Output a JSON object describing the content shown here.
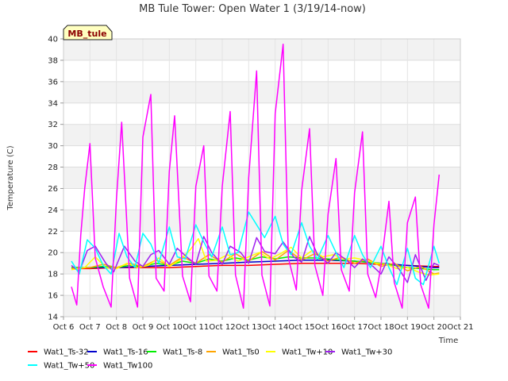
{
  "chart_data": {
    "type": "line",
    "title": "MB Tule Tower: Open Water 1 (3/19/14-now)",
    "xlabel": "Time",
    "ylabel": "Temperature (C)",
    "badge": "MB_tule",
    "xlim": [
      6,
      21
    ],
    "ylim": [
      14,
      40
    ],
    "grid": true,
    "legend_position": "bottom",
    "x_ticks": [
      {
        "x": 6,
        "label": "Oct 6"
      },
      {
        "x": 7,
        "label": "Oct 7"
      },
      {
        "x": 8,
        "label": "Oct 8"
      },
      {
        "x": 9,
        "label": "Oct 9"
      },
      {
        "x": 10,
        "label": "Oct 10"
      },
      {
        "x": 11,
        "label": "Oct 11"
      },
      {
        "x": 12,
        "label": "Oct 12"
      },
      {
        "x": 13,
        "label": "Oct 13"
      },
      {
        "x": 14,
        "label": "Oct 14"
      },
      {
        "x": 15,
        "label": "Oct 15"
      },
      {
        "x": 16,
        "label": "Oct 16"
      },
      {
        "x": 17,
        "label": "Oct 17"
      },
      {
        "x": 18,
        "label": "Oct 18"
      },
      {
        "x": 19,
        "label": "Oct 19"
      },
      {
        "x": 20,
        "label": "Oct 20"
      },
      {
        "x": 21,
        "label": "Oct 21"
      }
    ],
    "y_ticks": [
      14,
      16,
      18,
      20,
      22,
      24,
      26,
      28,
      30,
      32,
      34,
      36,
      38,
      40
    ],
    "series": [
      {
        "name": "Wat1_Ts-32",
        "color": "#ff0000",
        "x": [
          6.3,
          7.0,
          8.0,
          9.0,
          10.0,
          11.0,
          12.0,
          13.0,
          14.0,
          15.0,
          16.0,
          17.0,
          18.0,
          19.0,
          20.0,
          20.2
        ],
        "y": [
          18.5,
          18.5,
          18.6,
          18.6,
          18.6,
          18.7,
          18.8,
          18.8,
          18.9,
          19.0,
          19.0,
          19.0,
          18.9,
          18.8,
          18.7,
          18.7
        ]
      },
      {
        "name": "Wat1_Ts-16",
        "color": "#0000cc",
        "x": [
          6.3,
          7.0,
          8.0,
          9.0,
          10.0,
          11.0,
          12.0,
          13.0,
          14.0,
          15.0,
          16.0,
          17.0,
          18.0,
          19.0,
          20.0,
          20.2
        ],
        "y": [
          18.6,
          18.6,
          18.6,
          18.7,
          18.8,
          18.9,
          19.0,
          19.1,
          19.2,
          19.3,
          19.3,
          19.2,
          19.0,
          18.8,
          18.6,
          18.6
        ]
      },
      {
        "name": "Wat1_Ts-8",
        "color": "#00ee00",
        "x": [
          6.3,
          7.0,
          7.5,
          8.0,
          8.5,
          9.0,
          9.5,
          10.0,
          10.5,
          11.0,
          11.5,
          12.0,
          12.5,
          13.0,
          13.5,
          14.0,
          14.5,
          15.0,
          15.5,
          16.0,
          16.5,
          17.0,
          17.5,
          18.0,
          18.5,
          19.0,
          19.5,
          20.0,
          20.2
        ],
        "y": [
          18.6,
          18.6,
          18.7,
          18.6,
          18.8,
          18.7,
          19.0,
          18.8,
          19.2,
          19.0,
          19.4,
          19.2,
          19.5,
          19.3,
          19.6,
          19.4,
          19.6,
          19.5,
          19.5,
          19.4,
          19.3,
          19.2,
          19.1,
          19.0,
          18.8,
          18.6,
          18.5,
          18.4,
          18.4
        ]
      },
      {
        "name": "Wat1_Ts0",
        "color": "#ffa500",
        "x": [
          6.3,
          7.0,
          7.5,
          8.0,
          8.5,
          9.0,
          9.5,
          10.0,
          10.5,
          11.0,
          11.5,
          12.0,
          12.5,
          13.0,
          13.5,
          14.0,
          14.5,
          15.0,
          15.5,
          16.0,
          16.5,
          17.0,
          17.5,
          18.0,
          18.5,
          19.0,
          19.5,
          20.0,
          20.2
        ],
        "y": [
          18.5,
          18.6,
          18.9,
          18.6,
          19.0,
          18.7,
          19.3,
          18.8,
          19.6,
          19.0,
          19.8,
          19.1,
          19.9,
          19.2,
          20.1,
          19.3,
          20.2,
          19.3,
          19.9,
          19.2,
          19.6,
          19.0,
          19.4,
          18.7,
          19.0,
          18.3,
          18.7,
          18.0,
          18.1
        ]
      },
      {
        "name": "Wat1_Tw+10",
        "color": "#ffff00",
        "x": [
          6.3,
          6.8,
          7.2,
          7.6,
          8.0,
          8.4,
          8.8,
          9.2,
          9.6,
          10.0,
          10.4,
          10.8,
          11.1,
          11.4,
          11.8,
          12.2,
          12.6,
          13.0,
          13.4,
          13.8,
          14.2,
          14.6,
          15.0,
          15.4,
          15.8,
          16.2,
          16.6,
          17.0,
          17.4,
          17.8,
          18.2,
          18.6,
          19.0,
          19.4,
          19.8,
          20.2
        ],
        "y": [
          18.4,
          18.6,
          19.6,
          18.6,
          18.5,
          19.0,
          18.6,
          18.8,
          19.5,
          18.7,
          19.3,
          20.3,
          21.3,
          19.2,
          19.3,
          19.8,
          19.2,
          19.6,
          20.0,
          19.4,
          19.9,
          20.5,
          19.5,
          20.2,
          19.6,
          19.8,
          19.4,
          19.5,
          19.3,
          19.0,
          18.9,
          18.5,
          18.6,
          18.2,
          17.9,
          18.0
        ]
      },
      {
        "name": "Wat1_Tw+30",
        "color": "#a020f0",
        "x": [
          6.3,
          6.6,
          6.9,
          7.2,
          7.6,
          7.9,
          8.3,
          8.7,
          9.0,
          9.3,
          9.6,
          10.0,
          10.3,
          10.7,
          11.0,
          11.3,
          11.6,
          12.0,
          12.3,
          12.7,
          13.0,
          13.3,
          13.6,
          14.0,
          14.3,
          14.7,
          15.0,
          15.3,
          15.6,
          16.0,
          16.3,
          16.7,
          17.0,
          17.3,
          17.7,
          18.0,
          18.3,
          18.7,
          19.0,
          19.3,
          19.7,
          20.0,
          20.2
        ],
        "y": [
          18.8,
          18.2,
          20.2,
          20.6,
          19.0,
          18.2,
          20.6,
          19.2,
          18.7,
          19.8,
          20.2,
          18.9,
          20.4,
          19.5,
          18.9,
          21.5,
          20.0,
          18.9,
          20.6,
          20.0,
          19.0,
          21.4,
          20.1,
          19.9,
          21.0,
          19.6,
          19.1,
          21.5,
          19.8,
          19.0,
          20.0,
          19.3,
          18.6,
          19.4,
          18.7,
          18.0,
          19.6,
          18.4,
          17.2,
          19.8,
          17.4,
          19.0,
          18.8
        ]
      },
      {
        "name": "Wat1_Tw+50",
        "color": "#00ffff",
        "x": [
          6.3,
          6.6,
          6.9,
          7.2,
          7.5,
          7.8,
          8.1,
          8.4,
          8.7,
          9.0,
          9.3,
          9.6,
          10.0,
          10.3,
          10.6,
          11.0,
          11.3,
          11.6,
          12.0,
          12.3,
          12.6,
          13.0,
          13.3,
          13.6,
          14.0,
          14.3,
          14.6,
          15.0,
          15.3,
          15.6,
          16.0,
          16.3,
          16.6,
          17.0,
          17.3,
          17.6,
          18.0,
          18.3,
          18.6,
          19.0,
          19.3,
          19.6,
          20.0,
          20.2
        ],
        "y": [
          19.2,
          18.0,
          21.2,
          20.4,
          18.8,
          18.0,
          21.8,
          19.6,
          18.6,
          21.8,
          20.8,
          19.0,
          22.4,
          19.6,
          19.4,
          22.6,
          21.0,
          19.6,
          22.4,
          19.8,
          20.0,
          23.8,
          22.6,
          21.4,
          23.4,
          20.8,
          19.8,
          22.8,
          20.6,
          19.4,
          21.6,
          20.0,
          18.6,
          21.6,
          19.8,
          18.6,
          20.6,
          18.6,
          17.0,
          20.4,
          17.6,
          17.0,
          20.6,
          19.0
        ]
      },
      {
        "name": "Wat1_Tw100",
        "color": "#ff00ff",
        "x": [
          6.3,
          6.5,
          6.65,
          6.8,
          7.0,
          7.2,
          7.5,
          7.8,
          8.0,
          8.2,
          8.5,
          8.8,
          9.0,
          9.3,
          9.5,
          9.8,
          10.0,
          10.2,
          10.5,
          10.8,
          11.0,
          11.3,
          11.5,
          11.8,
          12.0,
          12.3,
          12.5,
          12.8,
          13.0,
          13.3,
          13.5,
          13.8,
          14.0,
          14.3,
          14.5,
          14.8,
          15.0,
          15.3,
          15.5,
          15.8,
          16.0,
          16.3,
          16.5,
          16.8,
          17.0,
          17.3,
          17.5,
          17.8,
          18.0,
          18.3,
          18.5,
          18.8,
          19.0,
          19.3,
          19.5,
          19.8,
          20.0,
          20.2
        ],
        "y": [
          16.8,
          15.1,
          21.6,
          26.0,
          30.2,
          19.5,
          16.8,
          14.9,
          25.0,
          32.2,
          17.6,
          14.9,
          30.8,
          34.8,
          17.6,
          16.4,
          27.6,
          32.8,
          17.8,
          15.4,
          26.2,
          30.0,
          17.8,
          16.4,
          26.2,
          33.2,
          17.9,
          14.8,
          27.0,
          37.0,
          17.9,
          15.0,
          33.0,
          39.5,
          19.5,
          16.5,
          25.8,
          31.6,
          18.8,
          16.0,
          23.6,
          28.8,
          18.4,
          16.4,
          25.6,
          31.3,
          18.0,
          15.8,
          18.8,
          24.8,
          17.2,
          14.8,
          22.8,
          25.2,
          17.0,
          14.8,
          22.6,
          27.3
        ]
      }
    ]
  }
}
